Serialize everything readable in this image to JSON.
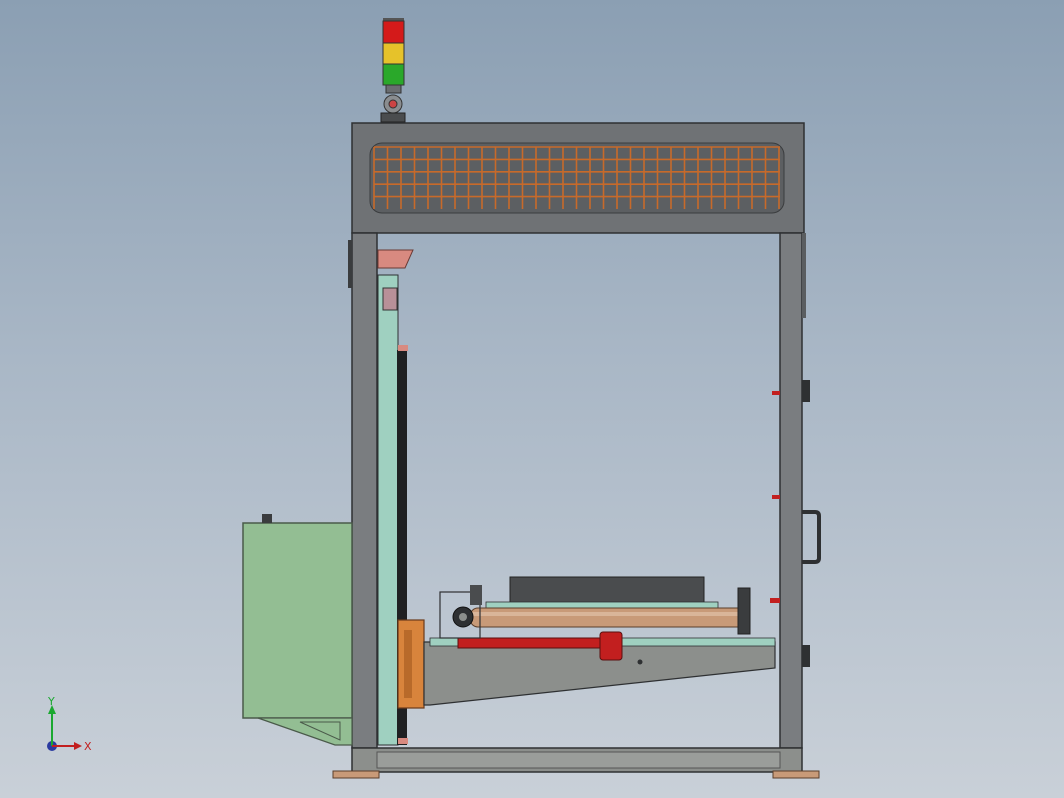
{
  "triad": {
    "x_label": "X",
    "y_label": "Y"
  },
  "colors": {
    "frame": "#6f7275",
    "frame_dark": "#3a3c3e",
    "mesh": "#c86a2a",
    "cabinet": "#93be93",
    "roller": "#c89a78",
    "red_bar": "#c21f1f",
    "base_plate": "#8c8f8c",
    "guide_panel": "#9fd0c0",
    "orange_block": "#d8843c",
    "light_red": "#d41a1a",
    "light_yellow": "#e6c22a",
    "light_green": "#2aa82a"
  }
}
